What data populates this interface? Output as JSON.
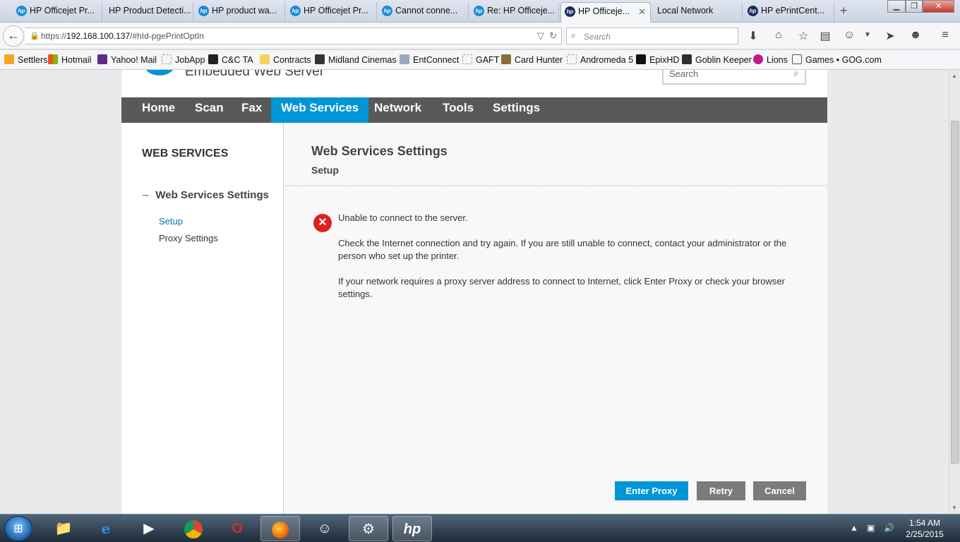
{
  "browser": {
    "tabs": [
      {
        "label": "HP Officejet Pr...",
        "icon": "hp-icon"
      },
      {
        "label": "HP Product Detecti...",
        "icon": "none"
      },
      {
        "label": "HP product wa...",
        "icon": "hp-icon"
      },
      {
        "label": "HP Officejet Pr...",
        "icon": "hp-icon"
      },
      {
        "label": "Cannot conne...",
        "icon": "hp-icon"
      },
      {
        "label": "Re: HP Officeje...",
        "icon": "hp-icon"
      },
      {
        "label": "HP Officeje...",
        "icon": "hp-icon",
        "active": true
      },
      {
        "label": "Local Network",
        "icon": "none"
      },
      {
        "label": "HP ePrintCent...",
        "icon": "hp-icon"
      }
    ],
    "new_tab": "+",
    "close_tab": "✕",
    "url_prefix": "https://",
    "url_host": "192.168.100.137",
    "url_path": "/#hId-pgePrintOptIn",
    "search_placeholder": "Search"
  },
  "bookmarks": [
    {
      "label": "Settlers",
      "color": "#f5a623"
    },
    {
      "label": "Hotmail",
      "color": "#e74c3c"
    },
    {
      "label": "Yahoo! Mail",
      "color": "#5b2d8e"
    },
    {
      "label": "JobApp",
      "color": "#ffffff"
    },
    {
      "label": "C&C TA",
      "color": "#222222"
    },
    {
      "label": "Contracts",
      "color": "#f4d35e"
    },
    {
      "label": "Midland Cinemas",
      "color": "#333333"
    },
    {
      "label": "EntConnect",
      "color": "#9aa7b8"
    },
    {
      "label": "GAFT",
      "color": "#ffffff"
    },
    {
      "label": "Card Hunter",
      "color": "#8a6d3b"
    },
    {
      "label": "Andromeda 5",
      "color": "#ffffff"
    },
    {
      "label": "EpixHD",
      "color": "#111111"
    },
    {
      "label": "Goblin Keeper",
      "color": "#2e2e2e"
    },
    {
      "label": "Lions",
      "color": "#c0168e"
    },
    {
      "label": "Games • GOG.com",
      "color": "#555555"
    }
  ],
  "ews": {
    "title": "Embedded Web Server",
    "search_placeholder": "Search",
    "nav": [
      "Home",
      "Scan",
      "Fax",
      "Web Services",
      "Network",
      "Tools",
      "Settings"
    ],
    "active_nav": "Web Services",
    "sidebar": {
      "title": "WEB SERVICES",
      "group": "Web Services Settings",
      "group_toggle": "–",
      "links": [
        "Setup",
        "Proxy Settings"
      ]
    },
    "content": {
      "title": "Web Services Settings",
      "subtitle": "Setup",
      "error_title": "Unable to connect to the server.",
      "message_1": "Check the Internet connection and try again. If you are still unable to connect, contact your administrator or the person who set up the printer.",
      "message_2": "If your network requires a proxy server address to connect to Internet, click Enter Proxy or check your browser settings."
    },
    "buttons": {
      "enter_proxy": "Enter Proxy",
      "retry": "Retry",
      "cancel": "Cancel"
    },
    "accent_color": "#0096d6"
  },
  "taskbar": {
    "time": "1:54 AM",
    "date": "2/25/2015"
  }
}
